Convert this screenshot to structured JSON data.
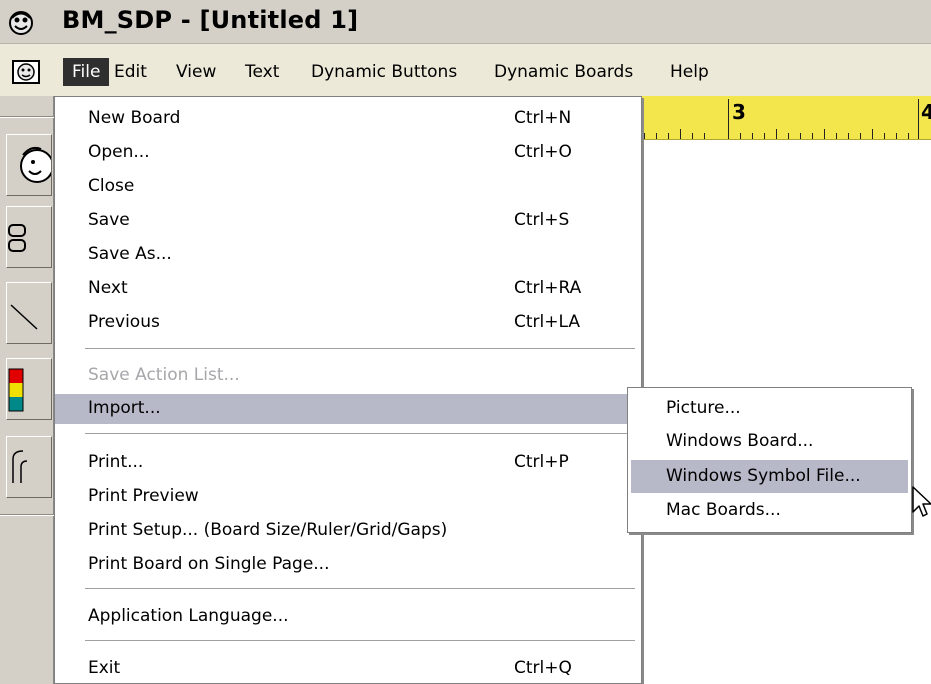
{
  "window": {
    "title": "BM_SDP - [Untitled 1]"
  },
  "menubar": {
    "items": [
      "File",
      "Edit",
      "View",
      "Text",
      "Dynamic Buttons",
      "Dynamic Boards",
      "Help"
    ],
    "active": "File"
  },
  "ruler": {
    "labels": [
      "3",
      "4"
    ],
    "color": "#f3e64d"
  },
  "file_menu": {
    "items": [
      {
        "label": "New Board",
        "shortcut": "Ctrl+N"
      },
      {
        "label": "Open...",
        "shortcut": "Ctrl+O"
      },
      {
        "label": "Close",
        "shortcut": ""
      },
      {
        "label": "Save",
        "shortcut": "Ctrl+S"
      },
      {
        "label": "Save As...",
        "shortcut": ""
      },
      {
        "label": "Next",
        "shortcut": "Ctrl+RA"
      },
      {
        "label": "Previous",
        "shortcut": "Ctrl+LA"
      },
      {
        "label": "Save Action List...",
        "shortcut": "",
        "disabled": true
      },
      {
        "label": "Import...",
        "shortcut": "",
        "submenu": true,
        "highlighted": true
      },
      {
        "label": "Print...",
        "shortcut": "Ctrl+P"
      },
      {
        "label": "Print Preview",
        "shortcut": ""
      },
      {
        "label": "Print Setup... (Board Size/Ruler/Grid/Gaps)",
        "shortcut": ""
      },
      {
        "label": "Print Board on Single Page...",
        "shortcut": ""
      },
      {
        "label": "Application Language...",
        "shortcut": ""
      },
      {
        "label": "Exit",
        "shortcut": "Ctrl+Q"
      }
    ]
  },
  "import_submenu": {
    "items": [
      {
        "label": "Picture..."
      },
      {
        "label": "Windows Board..."
      },
      {
        "label": "Windows Symbol File...",
        "highlighted": true
      },
      {
        "label": "Mac Boards..."
      }
    ]
  },
  "toolbar": {
    "tools": [
      "face-tool-icon",
      "button-tool-icon",
      "line-tool-icon",
      "color-palette-icon",
      "corner-tool-icon"
    ]
  },
  "colors": {
    "highlight": "#b7b8c8",
    "menubar": "#ece9d8",
    "menu_active": "#2f2f2f",
    "disabled_text": "#a7a6aa"
  }
}
